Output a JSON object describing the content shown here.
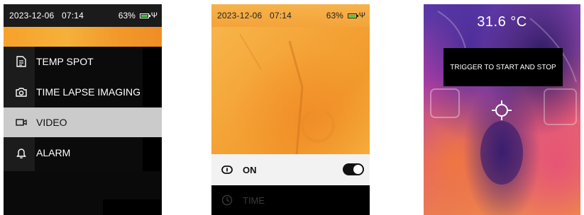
{
  "screen1": {
    "status": {
      "date": "2023-12-06",
      "time": "07:14",
      "battery": "63%"
    },
    "menu": [
      {
        "label": "TEMP SPOT",
        "icon": "document-icon",
        "selected": false
      },
      {
        "label": "TIME LAPSE IMAGING",
        "icon": "camera-icon",
        "selected": false
      },
      {
        "label": "VIDEO",
        "icon": "video-camera-icon",
        "selected": true
      },
      {
        "label": "ALARM",
        "icon": "bell-icon",
        "selected": false
      }
    ]
  },
  "screen2": {
    "status": {
      "date": "2023-12-06",
      "time": "07:14",
      "battery": "63%"
    },
    "setting": {
      "label": "ON",
      "icon": "power-icon",
      "toggle_on": true
    },
    "time_row": {
      "label": "TIME",
      "icon": "clock-icon"
    }
  },
  "screen3": {
    "temperature": "31.6 °C",
    "banner": "TRIGGER TO START AND STOP",
    "crosshair_icon": "crosshair-icon"
  },
  "colors": {
    "selected_row": "#cbcbcb",
    "battery_green": "#3bd13b",
    "thermal_orange": "#f4a235"
  }
}
